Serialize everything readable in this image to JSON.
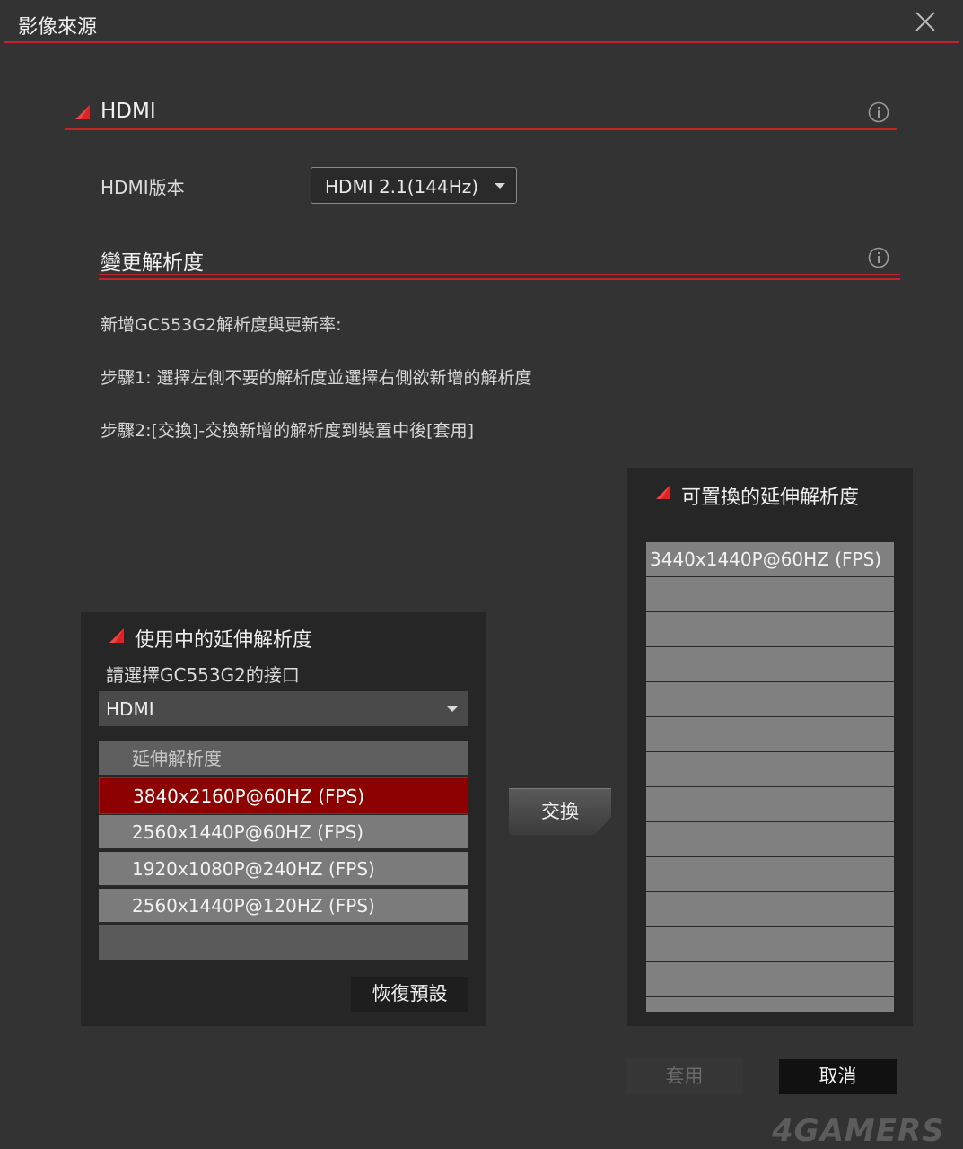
{
  "window": {
    "title": "影像來源"
  },
  "hdmi_section": {
    "title": "HDMI",
    "version_label": "HDMI版本",
    "version_value": "HDMI 2.1(144Hz)"
  },
  "resolution_section": {
    "title": "變更解析度",
    "lines": [
      "新增GC553G2解析度與更新率:",
      "步驟1: 選擇左側不要的解析度並選擇右側欲新增的解析度",
      "步驟2:[交換]-交換新增的解析度到裝置中後[套用]"
    ]
  },
  "active_panel": {
    "title": "使用中的延伸解析度",
    "port_label": "請選擇GC553G2的接口",
    "port_value": "HDMI",
    "list_header": "延伸解析度",
    "items": [
      "3840x2160P@60HZ (FPS)",
      "2560x1440P@60HZ (FPS)",
      "1920x1080P@240HZ (FPS)",
      "2560x1440P@120HZ (FPS)"
    ],
    "selected_index": 0,
    "restore_label": "恢復預設"
  },
  "swap_label": "交換",
  "replace_panel": {
    "title": "可置換的延伸解析度",
    "items": [
      "3440x1440P@60HZ (FPS)",
      "",
      "",
      "",
      "",
      "",
      "",
      "",
      "",
      "",
      "",
      "",
      "",
      ""
    ]
  },
  "footer": {
    "apply_label": "套用",
    "cancel_label": "取消"
  },
  "watermark": "4GAMERS",
  "colors": {
    "accent": "#c0252a",
    "selected_row": "#8c0000",
    "background": "#333333"
  }
}
